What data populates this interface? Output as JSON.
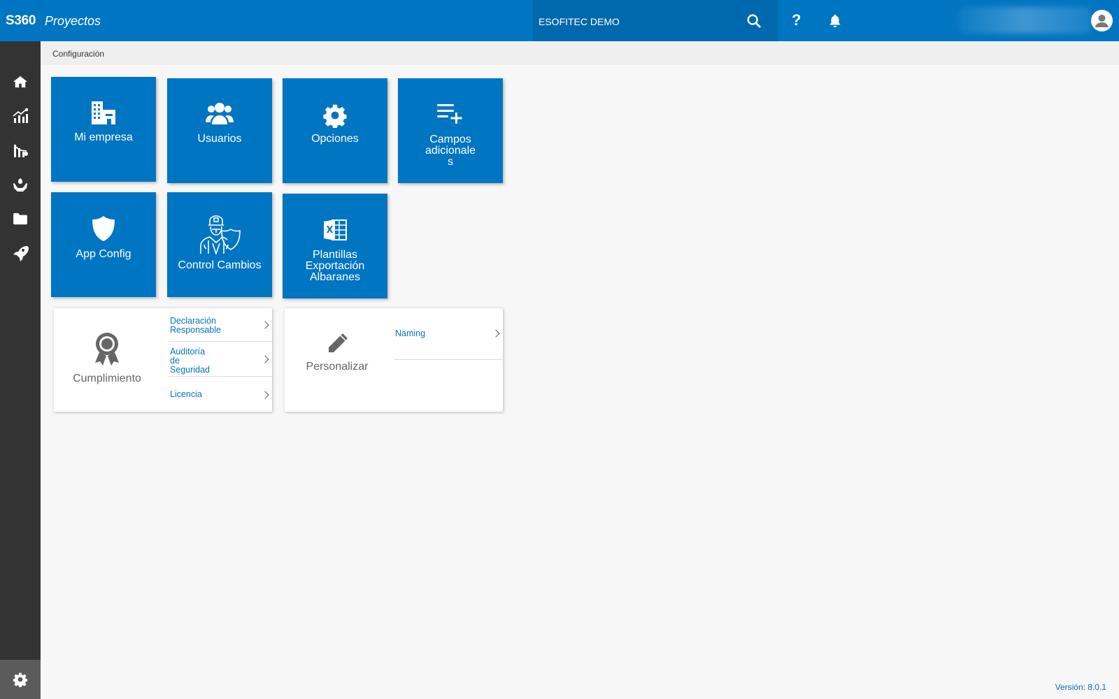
{
  "header": {
    "brand": "S360",
    "app_name": "Proyectos",
    "company": "ESOFITEC DEMO",
    "help_label": "?"
  },
  "breadcrumb": {
    "current": "Configuración"
  },
  "sidebar": {
    "items": [
      {
        "name": "home",
        "icon": "home-icon"
      },
      {
        "name": "analytics",
        "icon": "chart-growth-icon"
      },
      {
        "name": "reports",
        "icon": "chart-down-icon"
      },
      {
        "name": "care",
        "icon": "hands-plant-icon"
      },
      {
        "name": "documents",
        "icon": "folder-icon"
      },
      {
        "name": "launch",
        "icon": "rocket-icon"
      }
    ],
    "settings_icon": "gear-icon"
  },
  "tiles": [
    {
      "label": "Mi empresa",
      "icon": "building-icon"
    },
    {
      "label": "Usuarios",
      "icon": "users-icon"
    },
    {
      "label": "Opciones",
      "icon": "gear-icon"
    },
    {
      "label": "Campos adicionale s",
      "line1": "Campos",
      "line2": "adicionale",
      "line3": "s",
      "icon": "list-add-icon"
    },
    {
      "label": "App Config",
      "icon": "shield-icon"
    },
    {
      "label": "Control Cambios",
      "icon": "doctor-shield-icon"
    },
    {
      "label": "Plantillas Exportación Albaranes",
      "line1": "Plantillas",
      "line2": "Exportación",
      "line3": "Albaranes",
      "icon": "excel-icon"
    }
  ],
  "cards": {
    "compliance": {
      "title": "Cumplimiento",
      "icon": "award-ribbon-icon",
      "links": [
        {
          "line1": "Declaración",
          "line2": "Responsable"
        },
        {
          "line1": "Auditoría",
          "line2": "de",
          "line3": "Seguridad"
        },
        {
          "line1": "Licencia"
        }
      ]
    },
    "customize": {
      "title": "Personalizar",
      "icon": "pencil-icon",
      "links": [
        {
          "line1": "Naming"
        }
      ]
    }
  },
  "footer": {
    "version": "Versión: 8.0.1"
  },
  "colors": {
    "primary": "#0075c2",
    "sidebar": "#333333",
    "search_bg": "#0068ad"
  }
}
